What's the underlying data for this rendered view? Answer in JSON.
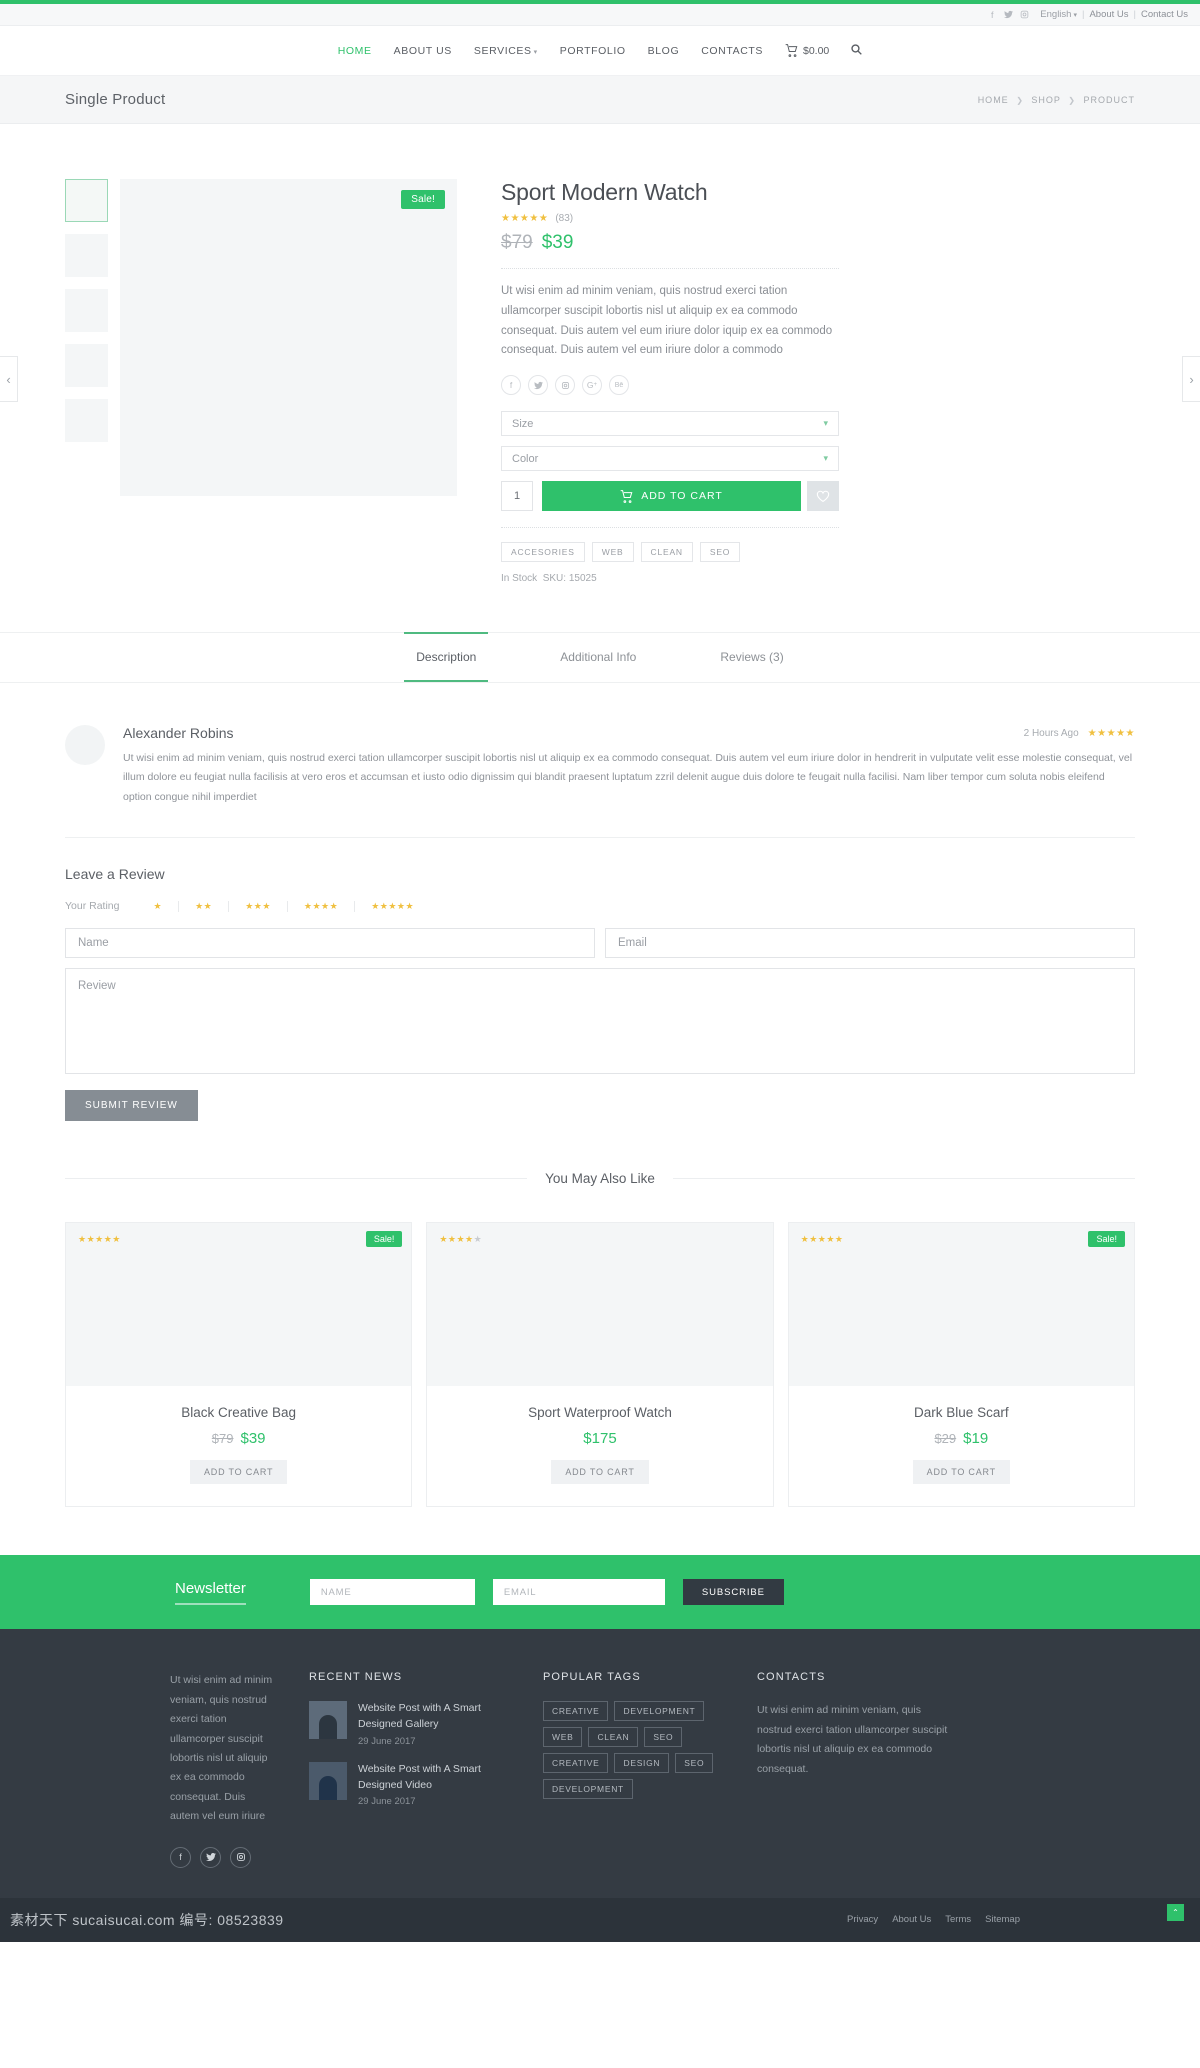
{
  "topbar": {
    "social": [
      "facebook-icon",
      "twitter-icon",
      "instagram-icon"
    ],
    "language": "English",
    "links": [
      "About Us",
      "Contact Us"
    ]
  },
  "nav": {
    "items": [
      "HOME",
      "ABOUT US",
      "SERVICES",
      "PORTFOLIO",
      "BLOG",
      "CONTACTS"
    ],
    "active": "HOME",
    "cart_total": "$0.00"
  },
  "breadcrumb": {
    "title": "Single Product",
    "items": [
      "HOME",
      "SHOP",
      "PRODUCT"
    ]
  },
  "gallery": {
    "sale_badge": "Sale!",
    "thumb_count": 5
  },
  "product": {
    "title": "Sport Modern Watch",
    "rating": 5,
    "rating_count": "(83)",
    "price_old": "$79",
    "price_new": "$39",
    "description": "Ut wisi enim ad minim veniam, quis nostrud exerci tation ullamcorper suscipit lobortis nisl ut aliquip ex ea commodo consequat. Duis autem vel eum iriure dolor iquip ex ea commodo consequat. Duis autem vel eum iriure dolor a commodo",
    "socials": [
      "facebook-icon",
      "twitter-icon",
      "instagram-icon",
      "google-plus-icon",
      "behance-icon"
    ],
    "size_label": "Size",
    "color_label": "Color",
    "quantity": "1",
    "add_to_cart": "ADD TO CART",
    "tags": [
      "ACCESORIES",
      "WEB",
      "CLEAN",
      "SEO"
    ],
    "stock": "In Stock",
    "sku": "SKU: 15025"
  },
  "tabs": {
    "items": [
      "Description",
      "Additional Info",
      "Reviews (3)"
    ],
    "active": "Description"
  },
  "review": {
    "author": "Alexander Robins",
    "time": "2 Hours Ago",
    "rating": 5,
    "text": "Ut wisi enim ad minim veniam, quis nostrud exerci tation ullamcorper suscipit lobortis nisl ut aliquip ex ea commodo consequat. Duis autem vel eum iriure dolor in hendrerit in vulputate velit esse molestie consequat, vel illum dolore eu feugiat nulla facilisis at vero eros et accumsan et iusto odio dignissim qui blandit praesent luptatum zzril delenit augue duis dolore te feugait nulla facilisi. Nam liber tempor cum soluta nobis eleifend option congue nihil imperdiet"
  },
  "leave_review": {
    "heading": "Leave a Review",
    "rating_label": "Your Rating",
    "rating_options": [
      1,
      2,
      3,
      4,
      5
    ],
    "name_placeholder": "Name",
    "email_placeholder": "Email",
    "review_placeholder": "Review",
    "submit_label": "SUBMIT REVIEW"
  },
  "also_like": {
    "heading": "You May Also Like",
    "products": [
      {
        "title": "Black Creative Bag",
        "stars": 5,
        "sale": "Sale!",
        "price_old": "$79",
        "price_new": "$39",
        "button": "ADD TO CART"
      },
      {
        "title": "Sport Waterproof Watch",
        "stars": 4,
        "sale": "",
        "price_old": "",
        "price_new": "$175",
        "button": "ADD TO CART"
      },
      {
        "title": "Dark Blue Scarf",
        "stars": 5,
        "sale": "Sale!",
        "price_old": "$29",
        "price_new": "$19",
        "button": "ADD TO CART"
      }
    ]
  },
  "newsletter": {
    "title": "Newsletter",
    "name_placeholder": "NAME",
    "email_placeholder": "EMAIL",
    "button": "SUBSCRIBE"
  },
  "footer": {
    "about_text": "Ut wisi enim ad minim veniam, quis nostrud exerci tation ullamcorper suscipit lobortis nisl ut aliquip ex ea commodo consequat. Duis autem vel eum iriure",
    "socials": [
      "facebook-icon",
      "twitter-icon",
      "instagram-icon"
    ],
    "recent_news_heading": "RECENT NEWS",
    "news": [
      {
        "title": "Website Post with A Smart Designed Gallery",
        "date": "29 June 2017"
      },
      {
        "title": "Website Post with A Smart Designed Video",
        "date": "29 June 2017"
      }
    ],
    "tags_heading": "POPULAR TAGS",
    "tags": [
      "CREATIVE",
      "DEVELOPMENT",
      "WEB",
      "CLEAN",
      "SEO",
      "CREATIVE",
      "DESIGN",
      "SEO",
      "DEVELOPMENT"
    ],
    "contacts_heading": "CONTACTS",
    "contacts_text": "Ut wisi enim ad minim veniam, quis nostrud exerci tation ullamcorper suscipit lobortis nisl ut aliquip ex ea commodo consequat."
  },
  "bottombar": {
    "watermark": "素材天下 sucaisucai.com 编号: 08523839",
    "links": [
      "Privacy",
      "About Us",
      "Terms",
      "Sitemap"
    ],
    "to_top": "⌃"
  },
  "colors": {
    "accent": "#2fc16b",
    "star": "#f0c040",
    "footer_bg": "#343b43",
    "bottom_bg": "#2c333a"
  }
}
